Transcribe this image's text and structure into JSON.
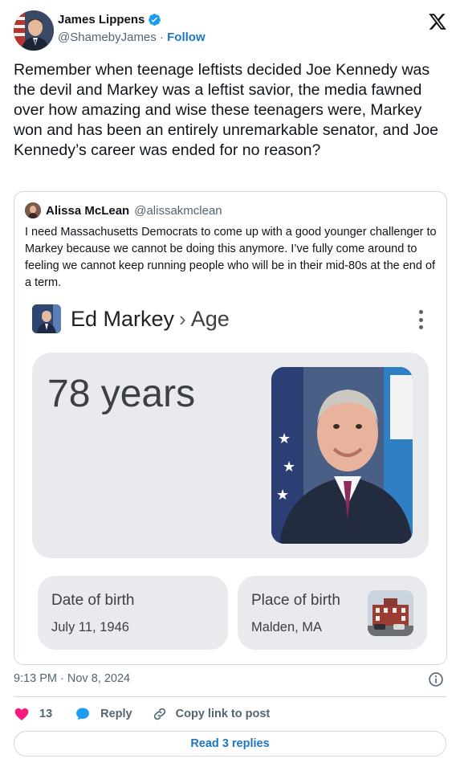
{
  "author": {
    "name": "James Lippens",
    "handle": "@ShamebyJames",
    "separator": "·",
    "follow_label": "Follow"
  },
  "tweet_text": "Remember when teenage leftists decided Joe Kennedy was the devil and Markey was a leftist savior, the media fawned over how amazing and wise these teenagers were, Markey won and has been an entirely unremarkable senator, and Joe Kennedy’s career was ended for no reason?",
  "quoted": {
    "name": "Alissa McLean",
    "handle": "@alissakmclean",
    "text": "I need Massachusetts Democrats to come up with a good younger challenger to Markey because we cannot be doing this anymore. I’ve fully come around to feeling we cannot keep running people who will be in their mid-80s at the end of a term.",
    "google": {
      "title": "Ed Markey",
      "separator": "›",
      "subtitle": "Age",
      "age": "78 years",
      "dob_label": "Date of birth",
      "dob_value": "July 11, 1946",
      "pob_label": "Place of birth",
      "pob_value": "Malden, MA"
    }
  },
  "footer": {
    "timestamp": "9:13 PM · Nov 8, 2024",
    "like_count": "13",
    "reply_label": "Reply",
    "copy_label": "Copy link to post",
    "read_replies_label": "Read 3 replies"
  },
  "colors": {
    "link": "#1d76c2",
    "like": "#f91880",
    "reply_icon": "#1d9bf0",
    "verified": "#1d9bf0",
    "secondary_text": "#536471",
    "card_bg": "#e8eaed"
  },
  "icons": [
    "verified-badge-icon",
    "x-logo-icon",
    "more-vert-icon",
    "heart-icon",
    "reply-bubble-icon",
    "link-icon",
    "info-icon"
  ]
}
